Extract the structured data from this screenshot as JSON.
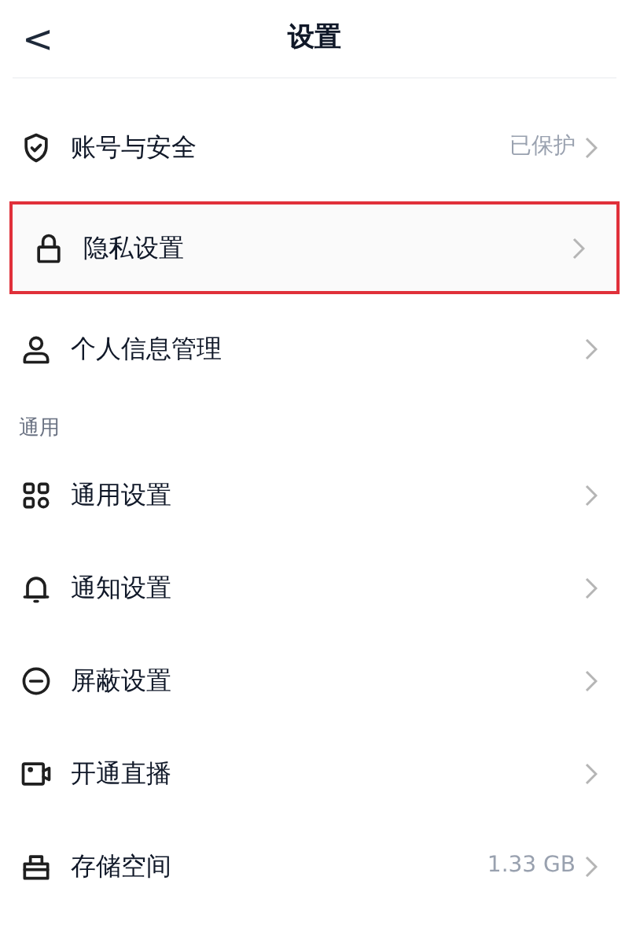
{
  "header": {
    "back": "<",
    "title": "设置"
  },
  "sections": [
    {
      "items": [
        {
          "kind": "shield",
          "label": "账号与安全",
          "value": "已保护",
          "highlighted": false
        },
        {
          "kind": "lock",
          "label": "隐私设置",
          "highlighted": true
        },
        {
          "kind": "person",
          "label": "个人信息管理",
          "highlighted": false
        }
      ]
    },
    {
      "title": "通用",
      "items": [
        {
          "kind": "grid",
          "label": "通用设置",
          "highlighted": false
        },
        {
          "kind": "bell",
          "label": "通知设置",
          "highlighted": false
        },
        {
          "kind": "minus",
          "label": "屏蔽设置",
          "highlighted": false
        },
        {
          "kind": "camera",
          "label": "开通直播",
          "highlighted": false
        },
        {
          "kind": "storage",
          "label": "存储空间",
          "value": "1.33 GB",
          "highlighted": false
        }
      ]
    }
  ]
}
